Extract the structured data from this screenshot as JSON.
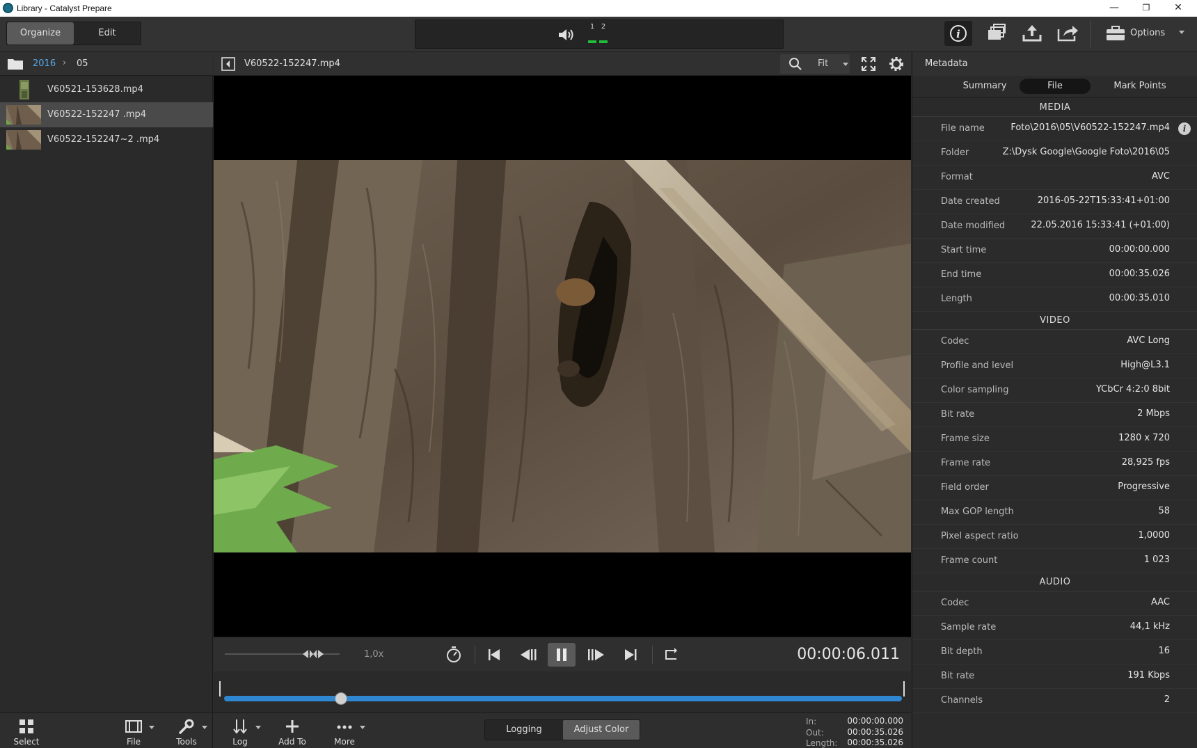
{
  "window": {
    "title": "Library - Catalyst Prepare",
    "minimize": "—",
    "restore": "❐",
    "close": "✕"
  },
  "toolbar": {
    "modes": [
      {
        "label": "Organize",
        "active": true
      },
      {
        "label": "Edit",
        "active": false
      }
    ],
    "meter": {
      "ch1": "1",
      "ch2": "2"
    },
    "options_label": "Options",
    "accent": "#2f86d1",
    "meter_color": "#1fbf3a"
  },
  "library": {
    "breadcrumb": [
      "2016",
      "05"
    ],
    "breadcrumb_sep": "›",
    "files": [
      {
        "name": "V60521-153628.mp4",
        "selected": false
      },
      {
        "name": "V60522-152247 .mp4",
        "selected": true
      },
      {
        "name": "V60522-152247~2 .mp4",
        "selected": false
      }
    ]
  },
  "viewer": {
    "clip_name": "V60522-152247.mp4",
    "zoom": "Fit",
    "speed": "1,0x",
    "timecode": "00:00:06.011",
    "playhead_fraction": 0.172
  },
  "bottom": {
    "select_label": "Select",
    "file_label": "File",
    "tools_label": "Tools",
    "log_label": "Log",
    "add_to_label": "Add To",
    "more_label": "More",
    "view_modes": [
      {
        "label": "Logging",
        "active": false
      },
      {
        "label": "Adjust Color",
        "active": true
      }
    ],
    "in_label": "In:",
    "in_value": "00:00:00.000",
    "out_label": "Out:",
    "out_value": "00:00:35.026",
    "length_label": "Length:",
    "length_value": "00:00:35.026"
  },
  "metadata": {
    "title": "Metadata",
    "tabs": [
      {
        "label": "Summary",
        "active": false
      },
      {
        "label": "File",
        "active": true
      },
      {
        "label": "Mark Points",
        "active": false
      }
    ],
    "media_header": "MEDIA",
    "media": [
      {
        "key": "File name",
        "value": "Foto\\2016\\05\\V60522-152247.mp4"
      },
      {
        "key": "Folder",
        "value": "Z:\\Dysk Google\\Google Foto\\2016\\05"
      },
      {
        "key": "Format",
        "value": "AVC"
      },
      {
        "key": "Date created",
        "value": "2016-05-22T15:33:41+01:00"
      },
      {
        "key": "Date modified",
        "value": "22.05.2016 15:33:41 (+01:00)"
      },
      {
        "key": "Start time",
        "value": "00:00:00.000"
      },
      {
        "key": "End time",
        "value": "00:00:35.026"
      },
      {
        "key": "Length",
        "value": "00:00:35.010"
      }
    ],
    "video_header": "VIDEO",
    "video": [
      {
        "key": "Codec",
        "value": "AVC Long"
      },
      {
        "key": "Profile and level",
        "value": "High@L3.1"
      },
      {
        "key": "Color sampling",
        "value": "YCbCr 4:2:0 8bit"
      },
      {
        "key": "Bit rate",
        "value": "2 Mbps"
      },
      {
        "key": "Frame size",
        "value": "1280 x 720"
      },
      {
        "key": "Frame rate",
        "value": "28,925 fps"
      },
      {
        "key": "Field order",
        "value": "Progressive"
      },
      {
        "key": "Max GOP length",
        "value": "58"
      },
      {
        "key": "Pixel aspect ratio",
        "value": "1,0000"
      },
      {
        "key": "Frame count",
        "value": "1 023"
      }
    ],
    "audio_header": "AUDIO",
    "audio": [
      {
        "key": "Codec",
        "value": "AAC"
      },
      {
        "key": "Sample rate",
        "value": "44,1 kHz"
      },
      {
        "key": "Bit depth",
        "value": "16"
      },
      {
        "key": "Bit rate",
        "value": "191 Kbps"
      },
      {
        "key": "Channels",
        "value": "2"
      }
    ]
  }
}
